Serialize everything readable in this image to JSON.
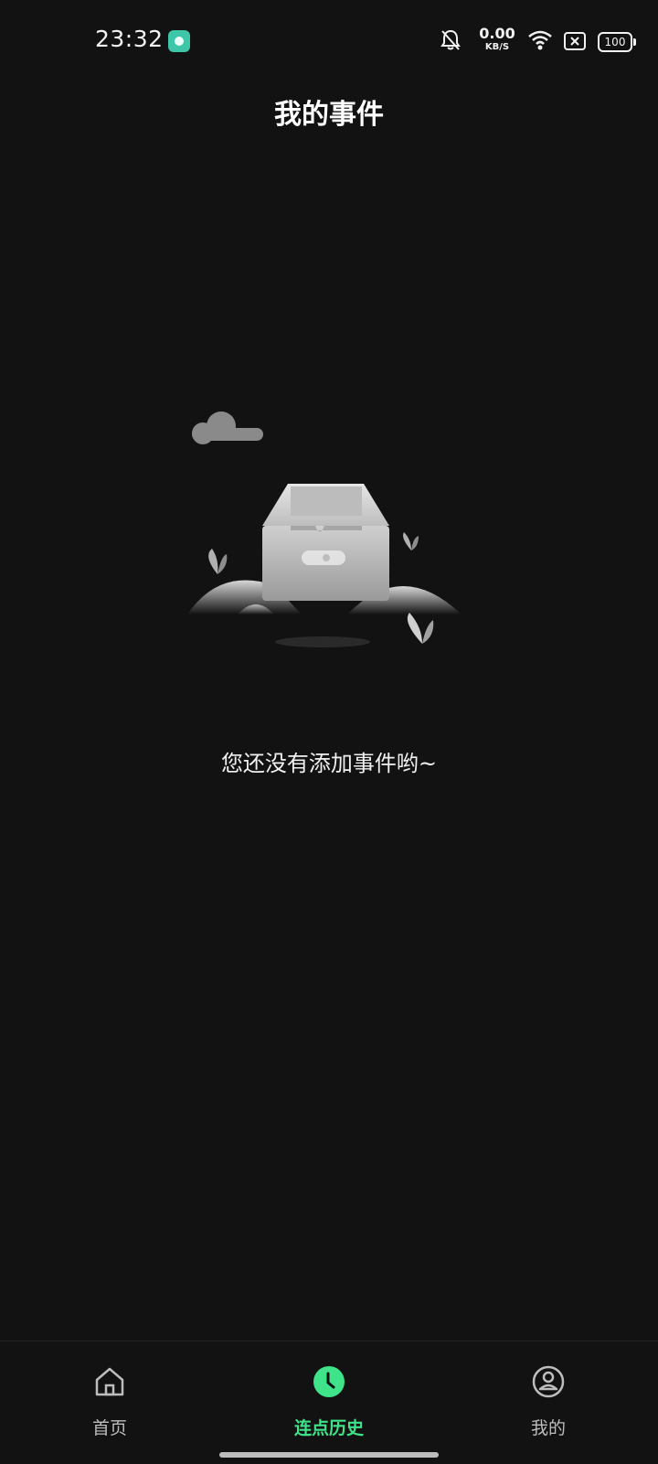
{
  "status_bar": {
    "time": "23:32",
    "net_speed_value": "0.00",
    "net_speed_unit": "KB/S",
    "battery": "100",
    "icons": [
      "app-badge-icon",
      "bell-off-icon",
      "wifi-icon",
      "x-box-icon",
      "battery-icon"
    ]
  },
  "header": {
    "title": "我的事件"
  },
  "empty_state": {
    "message": "您还没有添加事件哟~",
    "illustration": "empty-drawer-illustration"
  },
  "tab_bar": {
    "tabs": [
      {
        "label": "首页",
        "icon": "home-icon",
        "active": false
      },
      {
        "label": "连点历史",
        "icon": "clock-icon",
        "active": true
      },
      {
        "label": "我的",
        "icon": "user-icon",
        "active": false
      }
    ],
    "active_color": "#3fe38a",
    "inactive_color": "#bdbdbd"
  },
  "theme": {
    "background": "#121212",
    "text": "#ffffff"
  }
}
